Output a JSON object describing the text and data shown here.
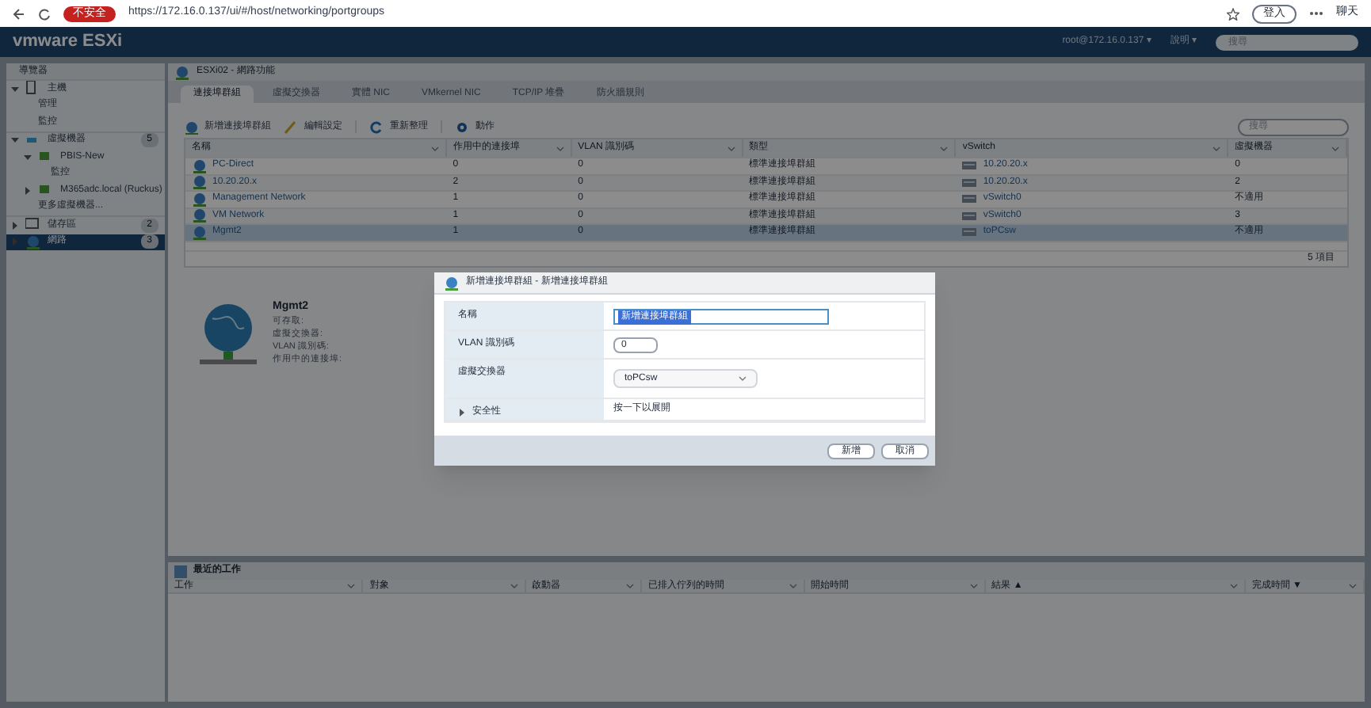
{
  "browser": {
    "security_badge": "不安全",
    "url": "https://172.16.0.137/ui/#/host/networking/portgroups",
    "profile": "登入",
    "chat": "聊天"
  },
  "header": {
    "logo": "vmware ESXi",
    "user": "root@172.16.0.137 ▾",
    "help": "說明 ▾",
    "search_placeholder": "搜尋"
  },
  "navigator": {
    "title": "導覽器",
    "items": [
      {
        "label": "主機",
        "kind": "host",
        "expanded": true,
        "selected": false,
        "children": [
          {
            "label": "管理",
            "selected": false
          },
          {
            "label": "監控",
            "selected": false
          }
        ]
      },
      {
        "label": "虛擬機器",
        "kind": "vms",
        "expanded": true,
        "selected": false,
        "badge": "5",
        "children": [
          {
            "label": "PBIS-New",
            "kind": "vm",
            "expanded": true,
            "selected": false,
            "children": [
              {
                "label": "監控",
                "selected": false
              }
            ]
          },
          {
            "label": "M365adc.local (Ruckus)",
            "kind": "vm",
            "expanded": false,
            "selected": false
          },
          {
            "label": "更多虛擬機器...",
            "selected": false
          }
        ]
      },
      {
        "label": "儲存區",
        "kind": "storage",
        "expanded": false,
        "selected": false,
        "badge": "2"
      },
      {
        "label": "網路",
        "kind": "network",
        "expanded": false,
        "selected": true,
        "badge": "3"
      }
    ]
  },
  "panel": {
    "title": "ESXi02 - 網路功能",
    "tabs": [
      {
        "label": "連接埠群組",
        "selected": true
      },
      {
        "label": "虛擬交換器",
        "selected": false
      },
      {
        "label": "實體 NIC",
        "selected": false
      },
      {
        "label": "VMkernel NIC",
        "selected": false
      },
      {
        "label": "TCP/IP 堆疊",
        "selected": false
      },
      {
        "label": "防火牆規則",
        "selected": false
      }
    ],
    "toolbar": [
      {
        "label": "新增連接埠群組",
        "kind": "add"
      },
      {
        "label": "編輯設定",
        "kind": "edit"
      },
      {
        "label": "重新整理",
        "kind": "refresh"
      },
      {
        "label": "動作",
        "kind": "gear"
      }
    ],
    "search_placeholder": "搜尋",
    "table": {
      "columns": [
        "名稱",
        "作用中的連接埠",
        "VLAN 識別碼",
        "類型",
        "vSwitch",
        "虛擬機器"
      ],
      "rows": [
        {
          "name": "PC-Direct",
          "active_ports": "0",
          "vlan": "0",
          "type": "標準連接埠群組",
          "vswitch": "10.20.20.x",
          "vms": "0",
          "selected": false
        },
        {
          "name": "10.20.20.x",
          "active_ports": "2",
          "vlan": "0",
          "type": "標準連接埠群組",
          "vswitch": "10.20.20.x",
          "vms": "2",
          "selected": false
        },
        {
          "name": "Management Network",
          "active_ports": "1",
          "vlan": "0",
          "type": "標準連接埠群組",
          "vswitch": "vSwitch0",
          "vms": "不適用",
          "selected": false
        },
        {
          "name": "VM Network",
          "active_ports": "1",
          "vlan": "0",
          "type": "標準連接埠群組",
          "vswitch": "vSwitch0",
          "vms": "3",
          "selected": false
        },
        {
          "name": "Mgmt2",
          "active_ports": "1",
          "vlan": "0",
          "type": "標準連接埠群組",
          "vswitch": "toPCsw",
          "vms": "不適用",
          "selected": true
        }
      ],
      "footer": "5 項目"
    },
    "details": {
      "name": "Mgmt2",
      "labels": [
        "可存取:",
        "虛擬交換器:",
        "VLAN 識別碼:",
        "作用中的連接埠:"
      ]
    }
  },
  "recent_tasks": {
    "title": "最近的工作",
    "columns": [
      "工作",
      "對象",
      "啟動器",
      "已排入佇列的時間",
      "開始時間",
      "結果 ▲",
      "完成時間 ▼"
    ]
  },
  "dialog": {
    "title": "新增連接埠群組 - 新增連接埠群組",
    "fields": [
      {
        "label": "名稱",
        "kind": "text",
        "value": "新增連接埠群組"
      },
      {
        "label": "VLAN 識別碼",
        "kind": "number",
        "value": "0"
      },
      {
        "label": "虛擬交換器",
        "kind": "select",
        "value": "toPCsw"
      },
      {
        "label": "安全性",
        "kind": "expander",
        "value": "按一下以展開",
        "expanded": false
      }
    ],
    "buttons": [
      "新增",
      "取消"
    ]
  }
}
